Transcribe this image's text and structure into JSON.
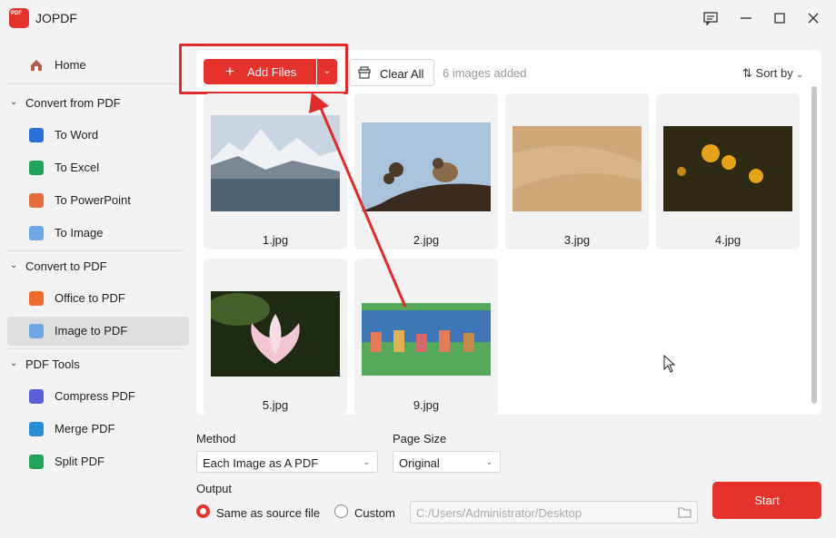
{
  "app": {
    "title": "JOPDF",
    "logo_text": "PDF"
  },
  "sidebar": {
    "home": "Home",
    "groups": [
      {
        "label": "Convert from PDF",
        "items": [
          "To Word",
          "To Excel",
          "To PowerPoint",
          "To Image"
        ]
      },
      {
        "label": "Convert to PDF",
        "items": [
          "Office to PDF",
          "Image to PDF"
        ]
      },
      {
        "label": "PDF Tools",
        "items": [
          "Compress PDF",
          "Merge PDF",
          "Split PDF"
        ]
      }
    ],
    "active": "Image to PDF"
  },
  "toolbar": {
    "add_files": "Add Files",
    "clear_all": "Clear All",
    "count": "6 images added",
    "sort_by": "Sort by"
  },
  "files": [
    {
      "name": "1.jpg",
      "icon": "snowy-mountain-lake-image"
    },
    {
      "name": "2.jpg",
      "icon": "sparrow-on-branch-image"
    },
    {
      "name": "3.jpg",
      "icon": "sand-texture-image"
    },
    {
      "name": "4.jpg",
      "icon": "yellow-flowers-image"
    },
    {
      "name": "5.jpg",
      "icon": "lotus-flower-image"
    },
    {
      "name": "9.jpg",
      "icon": "cartoon-scene-image"
    }
  ],
  "options": {
    "method_label": "Method",
    "method_value": "Each Image as A PDF",
    "page_size_label": "Page Size",
    "page_size_value": "Original",
    "output_label": "Output",
    "same_as_source": "Same as source file",
    "custom": "Custom",
    "output_path": "C:/Users/Administrator/Desktop",
    "selected_output": "Same as source file"
  },
  "start": "Start",
  "colors": {
    "accent": "#e5322d",
    "annotation": "#e02b2b"
  }
}
